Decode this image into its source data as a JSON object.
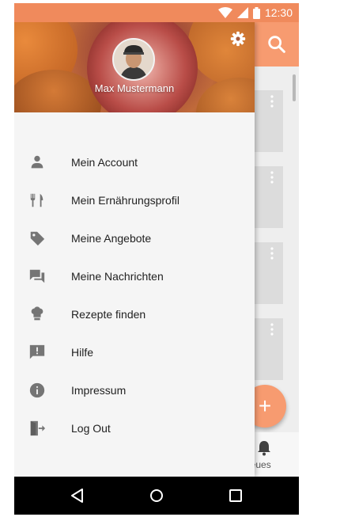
{
  "status_bar": {
    "time": "12:30"
  },
  "drawer": {
    "user_name": "Max Mustermann",
    "items": [
      {
        "label": "Mein Account",
        "icon": "person-icon"
      },
      {
        "label": "Mein Ernährungsprofil",
        "icon": "fork-knife-icon"
      },
      {
        "label": "Meine Angebote",
        "icon": "tag-icon"
      },
      {
        "label": "Meine Nachrichten",
        "icon": "chat-icon"
      },
      {
        "label": "Rezepte finden",
        "icon": "chef-hat-icon"
      },
      {
        "label": "Hilfe",
        "icon": "feedback-icon"
      },
      {
        "label": "Impressum",
        "icon": "info-icon"
      },
      {
        "label": "Log Out",
        "icon": "exit-icon"
      }
    ]
  },
  "background_app": {
    "bottom_nav_label": "Neues",
    "bottom_nav_label_visible": "leues",
    "fab_symbol": "+"
  },
  "colors": {
    "primary": "#f79b70",
    "status_bar": "#f08a5c",
    "drawer_background": "#f5f5f5",
    "icon": "#757575",
    "text": "#212121"
  }
}
